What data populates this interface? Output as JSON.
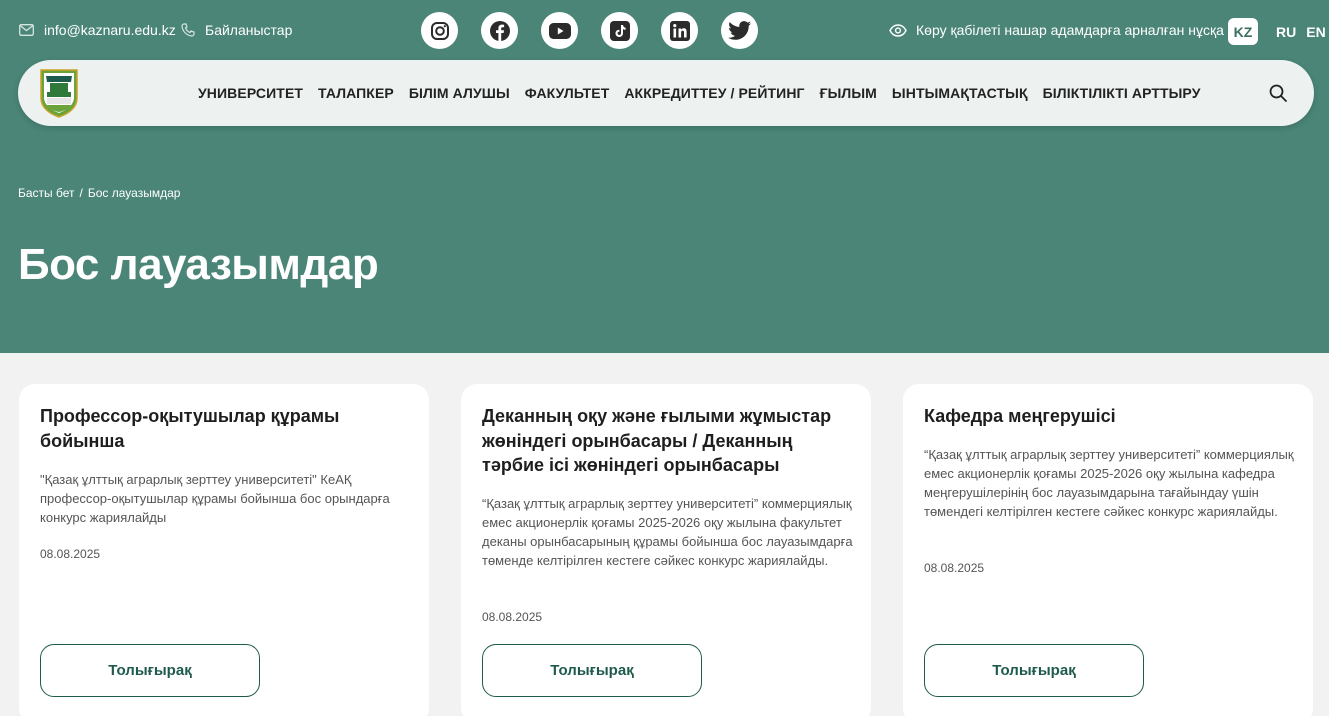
{
  "topbar": {
    "email": "info@kaznaru.edu.kz",
    "contacts_label": "Байланыстар",
    "socials": [
      "instagram-icon",
      "facebook-icon",
      "youtube-icon",
      "tiktok-icon",
      "linkedin-icon",
      "twitter-icon"
    ],
    "accessibility_label": "Көру қабілеті нашар адамдарға арналған нұсқа",
    "languages": [
      "KZ",
      "RU",
      "EN"
    ],
    "active_language": "KZ"
  },
  "nav": {
    "items": [
      "УНИВЕРСИТЕТ",
      "ТАЛАПКЕР",
      "БІЛІМ АЛУШЫ",
      "ФАКУЛЬТЕТ",
      "АККРЕДИТТЕУ / РЕЙТИНГ",
      "ҒЫЛЫМ",
      "ЫНТЫМАҚТАСТЫҚ",
      "БІЛІКТІЛІКТІ АРТТЫРУ"
    ]
  },
  "breadcrumb": {
    "home": "Басты бет",
    "separator": "/",
    "current": "Бос лауазымдар"
  },
  "page": {
    "title": "Бос лауазымдар"
  },
  "cards": [
    {
      "title": "Профессор-оқытушылар құрамы бойынша",
      "description": "\"Қазақ ұлттық аграрлық зерттеу университеті\" КеАҚ профессор-оқытушылар құрамы бойынша бос орындарға конкурс жариялайды",
      "date": "08.08.2025",
      "button": "Толығырақ"
    },
    {
      "title": "Деканның оқу және ғылыми жұмыстар жөніндегі орынбасары / Деканның тәрбие ісі жөніндегі орынбасары",
      "description": "“Қазақ ұлттық аграрлық зерттеу университеті” коммерциялық емес акционерлік қоғамы 2025-2026 оқу жылына факультет деканы орынбасарының құрамы бойынша бос лауазымдарға төменде келтірілген кестеге сәйкес конкурс жариялайды.",
      "date": "08.08.2025",
      "button": "Толығырақ"
    },
    {
      "title": "Кафедра меңгерушісі",
      "description": "“Қазақ ұлттық аграрлық зерттеу университеті” коммерциялық емес акционерлік қоғамы 2025-2026 оқу жылына кафедра меңгерушілерінің бос лауазымдарына тағайындау үшін төмендегі келтірілген кестеге сәйкес конкурс жариялайды.",
      "date": "08.08.2025",
      "button": "Толығырақ"
    }
  ],
  "colors": {
    "brand_green": "#4a8577",
    "button_green": "#1f5b4c",
    "nav_bg": "#edf2f1",
    "page_bg": "#f2f2f2"
  }
}
